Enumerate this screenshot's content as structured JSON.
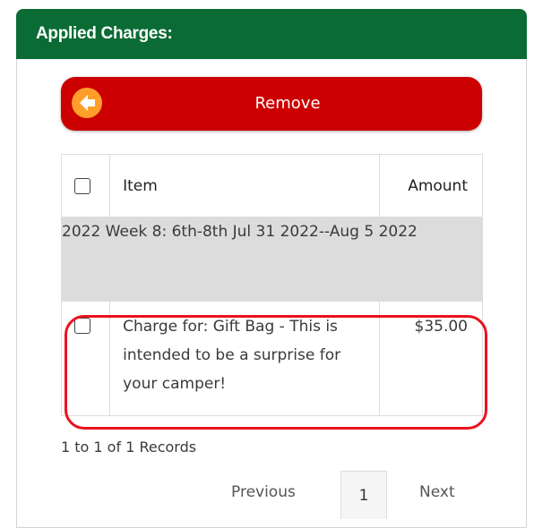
{
  "panel": {
    "title": "Applied Charges:"
  },
  "remove_button": {
    "label": "Remove",
    "icon": "arrow-left-icon"
  },
  "table": {
    "columns": [
      "Item",
      "Amount"
    ],
    "group_label": "2022 Week 8: 6th-8th Jul 31 2022--Aug 5 2022",
    "rows": [
      {
        "item": "Charge for: Gift Bag - This is intended to be a surprise for your camper!",
        "amount": "$35.00"
      }
    ]
  },
  "records_text": "1 to 1 of 1 Records",
  "pagination": {
    "previous": "Previous",
    "current_page": "1",
    "next": "Next"
  },
  "colors": {
    "header_green": "#0b6b35",
    "remove_red": "#cc0000",
    "icon_orange": "#ff9f2a",
    "highlight_red": "#e8131e",
    "group_gray": "#dcdcdc"
  }
}
